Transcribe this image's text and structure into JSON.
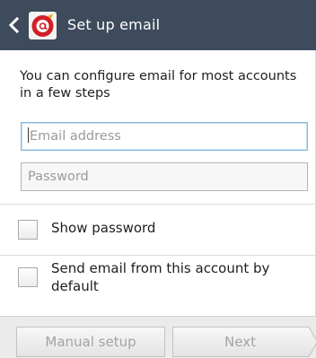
{
  "header": {
    "title": "Set up email",
    "back_icon": "chevron-left-icon",
    "app_icon": "email-app-icon",
    "background": "#3d4b5c"
  },
  "intro": {
    "text": "You can configure email for most accounts in a few steps"
  },
  "form": {
    "email": {
      "placeholder": "Email address",
      "value": "",
      "focused": true
    },
    "password": {
      "placeholder": "Password",
      "value": ""
    }
  },
  "options": {
    "show_password": {
      "label": "Show password",
      "checked": false
    },
    "default_sender": {
      "label": "Send email from this account by default",
      "checked": false
    }
  },
  "buttons": {
    "manual_setup": "Manual setup",
    "next": "Next"
  }
}
